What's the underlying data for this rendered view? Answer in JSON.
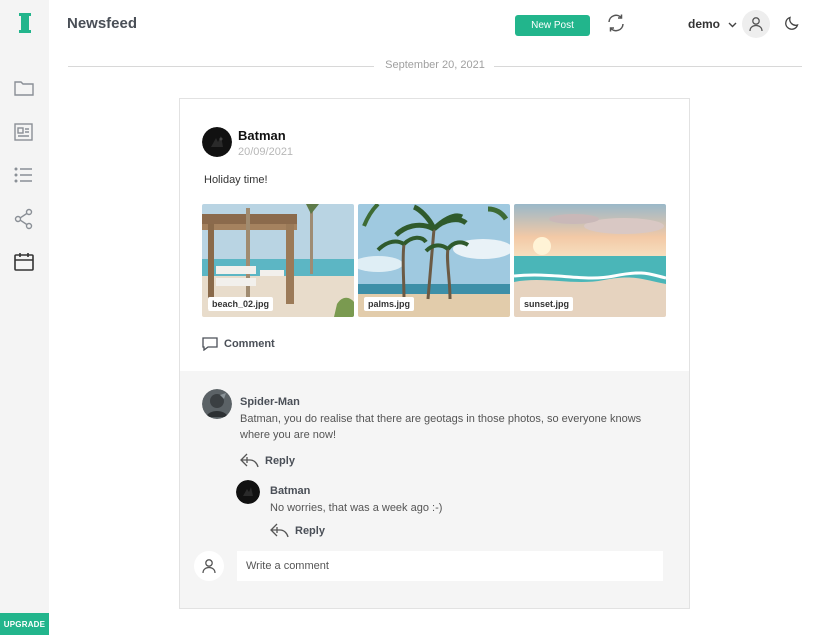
{
  "sidebar": {
    "items": [
      {
        "icon": "folder-icon"
      },
      {
        "icon": "newspaper-icon"
      },
      {
        "icon": "list-icon"
      },
      {
        "icon": "share-icon"
      },
      {
        "icon": "calendar-icon"
      }
    ],
    "upgrade_label": "UPGRADE"
  },
  "header": {
    "title": "Newsfeed",
    "new_post_label": "New Post",
    "user_name": "demo"
  },
  "feed": {
    "date_label": "September 20, 2021",
    "post": {
      "author": "Batman",
      "date": "20/09/2021",
      "text": "Holiday time!",
      "photos": [
        {
          "label": "beach_02.jpg"
        },
        {
          "label": "palms.jpg"
        },
        {
          "label": "sunset.jpg"
        }
      ],
      "comment_label": "Comment"
    },
    "comments": [
      {
        "author": "Spider-Man",
        "text": "Batman, you do realise that there are geotags in those photos, so everyone knows where you are now!",
        "reply_label": "Reply"
      },
      {
        "author": "Batman",
        "text": "No worries, that was a week ago :-)",
        "reply_label": "Reply"
      }
    ],
    "comment_input_placeholder": "Write a comment"
  },
  "colors": {
    "accent": "#22b58c",
    "sidebar_bg": "#f4f4f4",
    "comments_bg": "#f5f5f5"
  }
}
